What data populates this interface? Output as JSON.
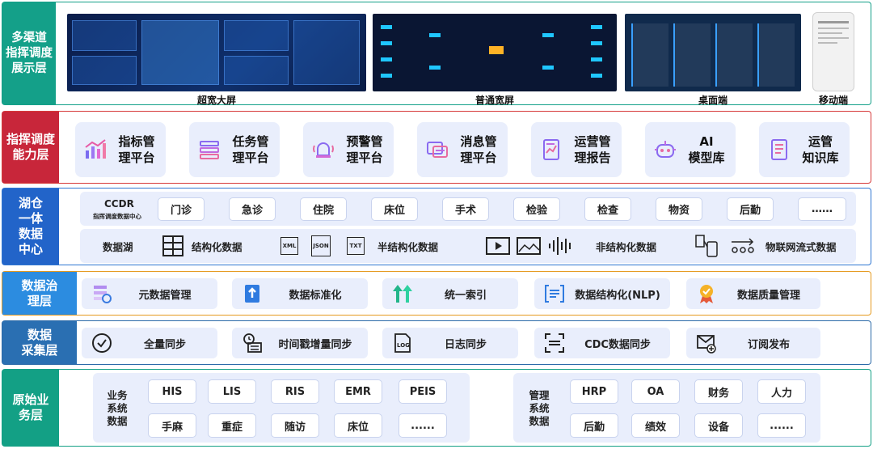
{
  "layers": {
    "display": {
      "label": "多渠道\n指挥调度\n展示层",
      "screens": [
        {
          "caption": "超宽大屏"
        },
        {
          "caption": "普通宽屏"
        },
        {
          "caption": "桌面端"
        },
        {
          "caption": "移动端"
        }
      ]
    },
    "capability": {
      "label": "指挥调度\n能力层",
      "items": [
        {
          "label": "指标管\n理平台",
          "icon": "chart-icon"
        },
        {
          "label": "任务管\n理平台",
          "icon": "task-list-icon"
        },
        {
          "label": "预警管\n理平台",
          "icon": "alarm-bell-icon"
        },
        {
          "label": "消息管\n理平台",
          "icon": "message-icon"
        },
        {
          "label": "运营管\n理报告",
          "icon": "report-icon"
        },
        {
          "label": "AI\n模型库",
          "icon": "robot-icon"
        },
        {
          "label": "运管\n知识库",
          "icon": "knowledge-book-icon"
        }
      ]
    },
    "data_center": {
      "label": "湖仓\n一体\n数据\n中心",
      "ccdr_title": "CCDR",
      "ccdr_subtitle": "指挥调度数据中心",
      "business_tags": [
        "门诊",
        "急诊",
        "住院",
        "床位",
        "手术",
        "检验",
        "检查",
        "物资",
        "后勤",
        "……"
      ],
      "lake_label": "数据湖",
      "structured": "结构化数据",
      "semi_structured": "半结构化数据",
      "semi_icons": [
        "XML",
        "JSON",
        "TXT"
      ],
      "unstructured": "非结构化数据",
      "iot": "物联网流式数据"
    },
    "governance": {
      "label": "数据治\n理层",
      "items": [
        {
          "label": "元数据管理",
          "icon": "metadata-icon"
        },
        {
          "label": "数据标准化",
          "icon": "upload-file-icon"
        },
        {
          "label": "统一索引",
          "icon": "index-icon"
        },
        {
          "label": "数据结构化(NLP)",
          "icon": "nlp-icon"
        },
        {
          "label": "数据质量管理",
          "icon": "quality-medal-icon"
        }
      ]
    },
    "collection": {
      "label": "数据\n采集层",
      "items": [
        {
          "label": "全量同步",
          "icon": "check-circle-icon"
        },
        {
          "label": "时间戳增量同步",
          "icon": "clock-calendar-icon"
        },
        {
          "label": "日志同步",
          "icon": "log-file-icon"
        },
        {
          "label": "CDC数据同步",
          "icon": "cdc-icon"
        },
        {
          "label": "订阅发布",
          "icon": "mail-subscribe-icon"
        }
      ]
    },
    "source": {
      "label": "原始业\n务层",
      "business": {
        "title": "业务\n系统\n数据",
        "items": [
          "HIS",
          "LIS",
          "RIS",
          "EMR",
          "PEIS",
          "手麻",
          "重症",
          "随访",
          "床位",
          "......"
        ]
      },
      "management": {
        "title": "管理\n系统\n数据",
        "items": [
          "HRP",
          "OA",
          "财务",
          "人力",
          "后勤",
          "绩效",
          "设备",
          "......"
        ]
      }
    }
  },
  "colors": {
    "teal": "#14a089",
    "red": "#c8263a",
    "blue": "#2264c9",
    "orange": "#e59a1f",
    "tile_bg": "#e9eefc"
  }
}
